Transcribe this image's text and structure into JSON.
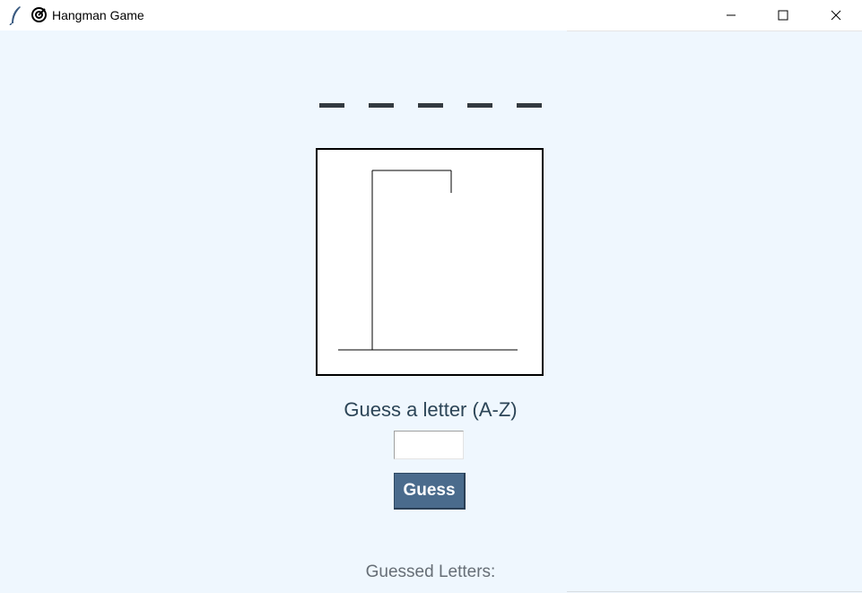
{
  "window": {
    "title": "Hangman Game",
    "icons": {
      "feather": "feather-icon",
      "app": "target-icon"
    },
    "controls": [
      "minimize-icon",
      "maximize-icon",
      "close-icon"
    ]
  },
  "game": {
    "masked_word": [
      "_",
      "_",
      "_",
      "_",
      "_"
    ],
    "masked_word_text": "_ _ _ _ _",
    "prompt": "Guess a letter (A-Z)",
    "entry_value": "",
    "guess_button_label": "Guess",
    "guessed_letters_label": "Guessed Letters:",
    "guessed_letters": "",
    "gallows_stage": 0
  },
  "colors": {
    "background": "#eff7fe",
    "button": "#4a6b8c",
    "prompt_text": "#2c4557",
    "word_text": "#333a40"
  }
}
